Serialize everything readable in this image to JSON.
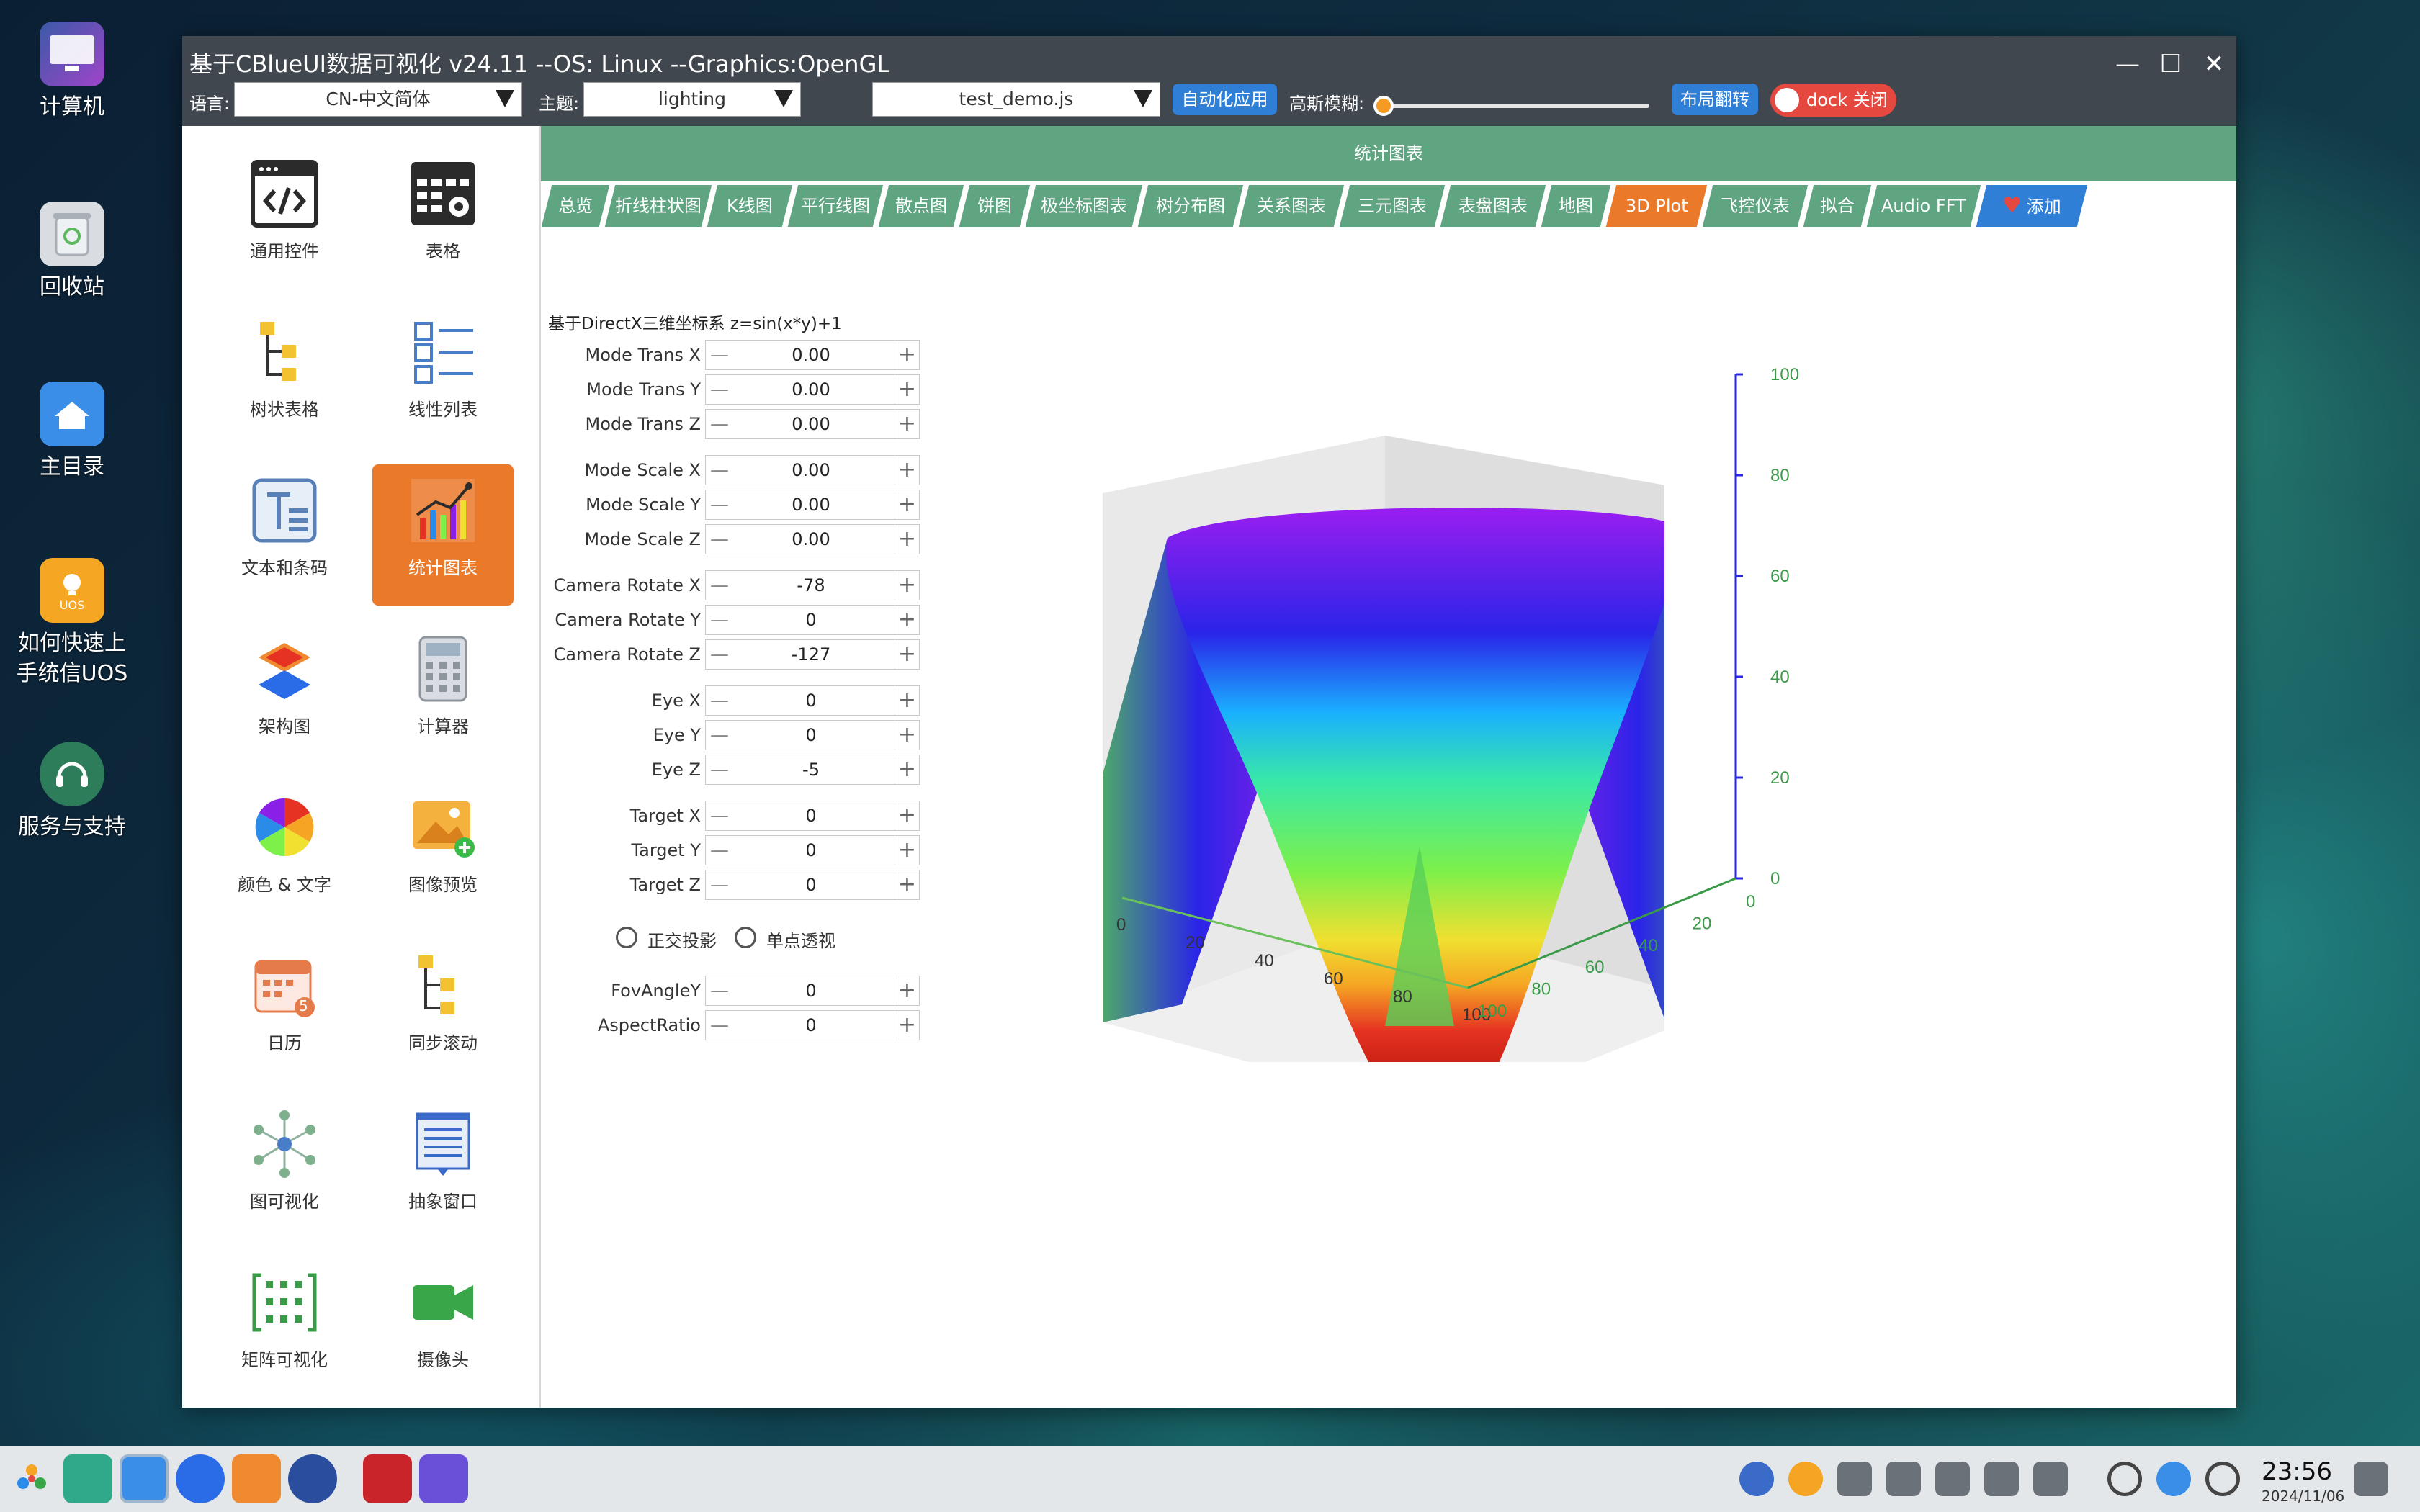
{
  "desktop": {
    "icons": [
      {
        "label": "计算机",
        "icon": "computer-icon"
      },
      {
        "label": "回收站",
        "icon": "trash-icon"
      },
      {
        "label": "主目录",
        "icon": "home-folder-icon"
      },
      {
        "label": "如何快速上手统信UOS",
        "icon": "uos-tips-icon",
        "badge": "UOS"
      },
      {
        "label": "服务与支持",
        "icon": "support-icon"
      }
    ]
  },
  "window": {
    "title": "基于CBlueUI数据可视化  v24.11  --OS: Linux  --Graphics:OpenGL",
    "controls": {
      "minimize": "—",
      "maximize": "☐",
      "close": "✕"
    },
    "toolbar": {
      "language_label": "语言:",
      "language_value": "CN-中文简体",
      "theme_label": "主题:",
      "theme_value": "lighting",
      "script_value": "test_demo.js",
      "auto_apply_label": "自动化应用",
      "blur_label": "高斯模糊:",
      "blur_level": 0.0,
      "layout_flip_label": "布局翻转",
      "dock_label": "dock 关闭"
    },
    "nav": [
      {
        "label": "通用控件",
        "icon": "code-window-icon"
      },
      {
        "label": "表格",
        "icon": "table-settings-icon"
      },
      {
        "label": "树状表格",
        "icon": "tree-table-icon"
      },
      {
        "label": "线性列表",
        "icon": "linear-list-icon"
      },
      {
        "label": "文本和条码",
        "icon": "text-barcode-icon"
      },
      {
        "label": "统计图表",
        "icon": "statistics-chart-icon",
        "active": true
      },
      {
        "label": "架构图",
        "icon": "architecture-icon"
      },
      {
        "label": "计算器",
        "icon": "calculator-icon"
      },
      {
        "label": "颜色 & 文字",
        "icon": "color-wheel-icon"
      },
      {
        "label": "图像预览",
        "icon": "image-preview-icon"
      },
      {
        "label": "日历",
        "icon": "calendar-icon",
        "badge": "5"
      },
      {
        "label": "同步滚动",
        "icon": "sync-scroll-icon"
      },
      {
        "label": "图可视化",
        "icon": "graph-visual-icon"
      },
      {
        "label": "抽象窗口",
        "icon": "abstract-window-icon"
      },
      {
        "label": "矩阵可视化",
        "icon": "matrix-icon"
      },
      {
        "label": "摄像头",
        "icon": "camera-icon"
      }
    ],
    "content": {
      "header": "统计图表",
      "tabs": [
        "总览",
        "折线柱状图",
        "K线图",
        "平行线图",
        "散点图",
        "饼图",
        "极坐标图表",
        "树分布图",
        "关系图表",
        "三元图表",
        "表盘图表",
        "地图",
        "3D Plot",
        "飞控仪表",
        "拟合",
        "Audio FFT",
        "添加"
      ],
      "active_tab": "3D Plot",
      "caption": "基于DirectX三维坐标系 z=sin(x*y)+1",
      "params": [
        {
          "label": "Mode Trans X",
          "value": "0.00"
        },
        {
          "label": "Mode Trans Y",
          "value": "0.00"
        },
        {
          "label": "Mode Trans Z",
          "value": "0.00"
        },
        {
          "label": "Mode Scale X",
          "value": "0.00"
        },
        {
          "label": "Mode Scale Y",
          "value": "0.00"
        },
        {
          "label": "Mode Scale Z",
          "value": "0.00"
        },
        {
          "label": "Camera Rotate X",
          "value": "-78"
        },
        {
          "label": "Camera Rotate Y",
          "value": "0"
        },
        {
          "label": "Camera Rotate Z",
          "value": "-127"
        },
        {
          "label": "Eye X",
          "value": "0"
        },
        {
          "label": "Eye Y",
          "value": "0"
        },
        {
          "label": "Eye Z",
          "value": "-5"
        },
        {
          "label": "Target X",
          "value": "0"
        },
        {
          "label": "Target Y",
          "value": "0"
        },
        {
          "label": "Target Z",
          "value": "0"
        }
      ],
      "projection": [
        {
          "label": "正交投影",
          "checked": false
        },
        {
          "label": "单点透视",
          "checked": false
        }
      ],
      "extra_params": [
        {
          "label": "FovAngleY",
          "value": "0"
        },
        {
          "label": "AspectRatio",
          "value": "0"
        }
      ]
    }
  },
  "chart_data": {
    "type": "surface",
    "title": "",
    "z_ticks": [
      "0",
      "20",
      "40",
      "60",
      "80",
      "100"
    ],
    "x_ticks": [
      "0",
      "20",
      "40",
      "60",
      "80",
      "100"
    ],
    "y_ticks": [
      "0",
      "20",
      "40",
      "60",
      "80",
      "100"
    ],
    "zlim": [
      0,
      100
    ],
    "xlim": [
      0,
      100
    ],
    "ylim": [
      0,
      100
    ],
    "colormap": [
      "#e53222",
      "#f5a523",
      "#f0e030",
      "#7ef04a",
      "#38e8a8",
      "#1ab0ff",
      "#2a24e8",
      "#8a20e8"
    ]
  },
  "taskbar": {
    "apps": [
      "launcher-icon",
      "file-manager-icon",
      "desktop-window-icon",
      "browser-icon",
      "app-store-icon",
      "settings-icon",
      "terminal-icon",
      "dev-tool-icon"
    ],
    "tray": [
      "shield-icon",
      "input-method-icon",
      "keyboard-icon",
      "usb-icon",
      "volume-mute-icon",
      "pen-icon",
      "expand-arrow-icon",
      "search-icon",
      "network-icon",
      "power-icon",
      "notification-icon"
    ],
    "time": "23:56",
    "date": "2024/11/06"
  },
  "colors": {
    "accent_orange": "#ea7a2a",
    "tab_green": "#5fa581",
    "title_bar": "#40474f",
    "button_blue": "#2f7fd6",
    "dock_red": "#e5483f"
  }
}
